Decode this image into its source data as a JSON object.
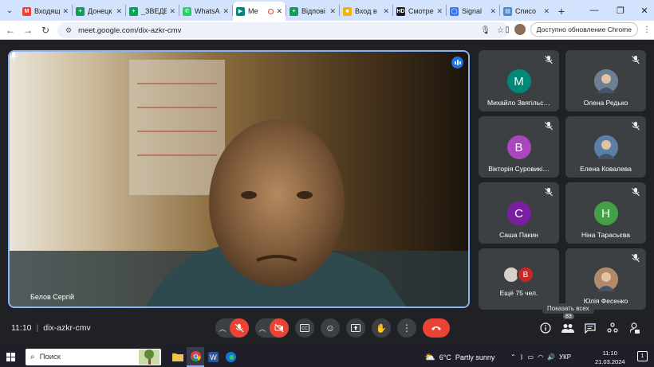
{
  "browser": {
    "tabs": [
      {
        "title": "Входящ",
        "color": "#ea4335",
        "glyph": "M"
      },
      {
        "title": "Донецк",
        "color": "#0f9d58",
        "glyph": "+"
      },
      {
        "title": "_ЗВЕДЕ",
        "color": "#0f9d58",
        "glyph": "+"
      },
      {
        "title": "WhatsA",
        "color": "#25d366",
        "glyph": "✆"
      },
      {
        "title": "Ме",
        "color": "#00897b",
        "glyph": "▶",
        "active": true
      },
      {
        "title": "Відпові",
        "color": "#0f9d58",
        "glyph": "+"
      },
      {
        "title": "Вход в",
        "color": "#f4b400",
        "glyph": "■"
      },
      {
        "title": "Смотре",
        "color": "#1b1b1b",
        "glyph": "HD"
      },
      {
        "title": "Signal",
        "color": "#3a76f0",
        "glyph": "◯"
      },
      {
        "title": "Списо",
        "color": "#4a8ad1",
        "glyph": "▤"
      }
    ],
    "url": "meet.google.com/dix-azkr-cmv",
    "update_label": "Доступно обновление Chrome"
  },
  "meet": {
    "speaker_name": "Белов Сергій",
    "time": "11:10",
    "meeting_code": "dix-azkr-cmv",
    "people_count": "83",
    "show_all_tooltip": "Показать всех",
    "participants": [
      {
        "name": "Михайло Звягільс…",
        "initial": "M",
        "color": "#00897b",
        "photo": false
      },
      {
        "name": "Олена Редько",
        "initial": "",
        "color": "#6d7f93",
        "photo": true
      },
      {
        "name": "Вікторія Суровикі…",
        "initial": "В",
        "color": "#ab47bc",
        "photo": false
      },
      {
        "name": "Елена Ковалева",
        "initial": "",
        "color": "#5a7fa8",
        "photo": true
      },
      {
        "name": "Саша Пакин",
        "initial": "С",
        "color": "#7b1fa2",
        "photo": false
      },
      {
        "name": "Ніна Тарасьєва",
        "initial": "Н",
        "color": "#43a047",
        "photo": false
      },
      {
        "name": "Ещё 75 чел.",
        "initial": "В",
        "color": "#c62828",
        "photo": false,
        "more": true
      },
      {
        "name": "Юлія Фесенко",
        "initial": "",
        "color": "#b08a6a",
        "photo": true
      }
    ]
  },
  "taskbar": {
    "search_placeholder": "Поиск",
    "weather_temp": "6°C",
    "weather_desc": "Partly sunny",
    "lang": "УКР",
    "clock_time": "11:10",
    "clock_date": "21.03.2024",
    "notifications": "1"
  },
  "colors": {
    "accent": "#8ab4f8",
    "end_call": "#ea4335",
    "meet_bg": "#202124",
    "tile_bg": "#3c4043"
  }
}
